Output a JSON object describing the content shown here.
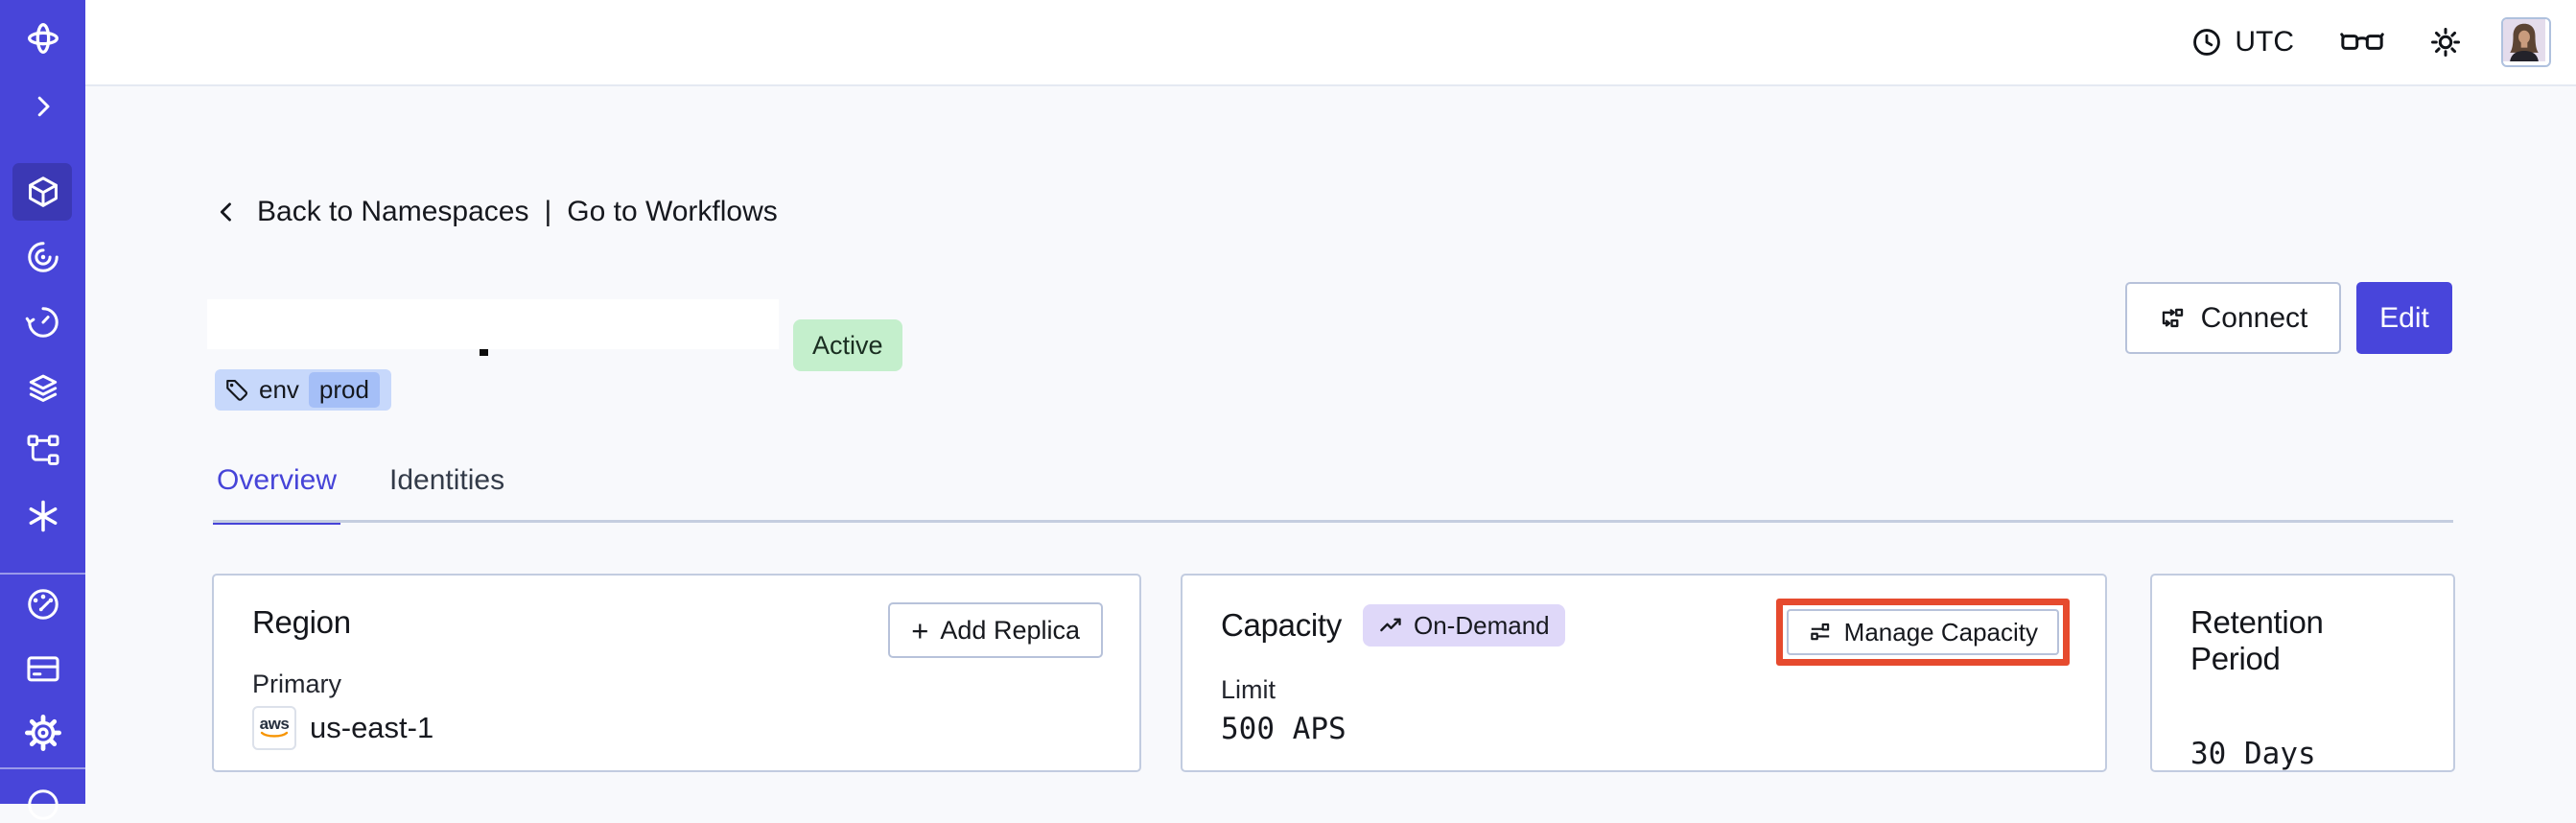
{
  "topbar": {
    "timezone_label": "UTC",
    "icons": [
      "clock-icon",
      "glasses-icon",
      "sun-icon",
      "avatar"
    ]
  },
  "sidebar": {
    "color": "#4845D9",
    "active_item_color": "#3B38B4",
    "items": [
      {
        "name": "temporal-logo",
        "active": false
      },
      {
        "name": "expand-nav",
        "active": false
      },
      {
        "name": "namespaces",
        "active": true
      },
      {
        "name": "workflows",
        "active": false
      },
      {
        "name": "schedules",
        "active": false
      },
      {
        "name": "stacks",
        "active": false
      },
      {
        "name": "pipelines",
        "active": false
      },
      {
        "name": "nexus",
        "active": false
      },
      {
        "name": "usage",
        "active": false
      },
      {
        "name": "billing",
        "active": false
      },
      {
        "name": "settings",
        "active": false
      },
      {
        "name": "support",
        "active": false
      }
    ]
  },
  "breadcrumb": {
    "back_label": "Back to Namespaces",
    "separator": "|",
    "workflows_label": "Go to Workflows"
  },
  "namespace_header": {
    "name_redacted": "",
    "status_badge": "Active",
    "tag": {
      "key": "env",
      "value": "prod"
    },
    "connect_label": "Connect",
    "edit_label": "Edit"
  },
  "tabs": [
    {
      "label": "Overview",
      "active": true
    },
    {
      "label": "Identities",
      "active": false
    }
  ],
  "cards": {
    "region": {
      "title": "Region",
      "plus": "+",
      "add_replica_label": "Add Replica",
      "row_label": "Primary",
      "provider_label": "aws",
      "value": "us-east-1"
    },
    "capacity": {
      "title": "Capacity",
      "badge": "On-Demand",
      "manage_label": "Manage Capacity",
      "row_label": "Limit",
      "value": "500 APS"
    },
    "retention": {
      "title": "Retention Period",
      "value": "30 Days"
    }
  },
  "colors": {
    "page_bg": "#F8F9FC",
    "sidebar": "#4845D9",
    "accent": "#4644D8",
    "edit_button": "#4845DB",
    "status_badge_bg": "#C4EFCC",
    "tag_bg": "#C7D8FB",
    "tag_chip_bg": "#A5BFF7",
    "ondemand_badge_bg": "#DFD8F9",
    "highlight_border": "#E64A2E",
    "card_border": "#C2CCE0",
    "aws_smile": "#F79400"
  }
}
